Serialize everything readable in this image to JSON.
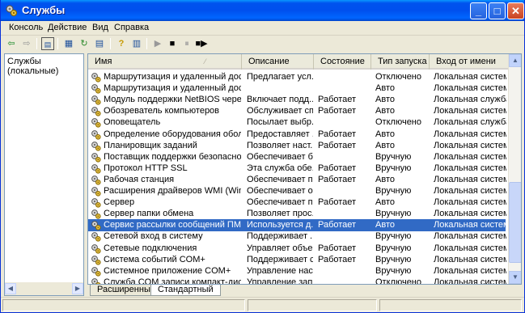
{
  "window": {
    "title": "Службы"
  },
  "menu": [
    "Консоль",
    "Действие",
    "Вид",
    "Справка"
  ],
  "tree": {
    "root": "Службы (локальные)"
  },
  "columns": [
    "Имя",
    "Описание",
    "Состояние",
    "Тип запуска",
    "Вход от имени"
  ],
  "rows": [
    {
      "name": "Маршрутизация и удаленный доступ",
      "desc": "Предлагает усл...",
      "state": "",
      "startup": "Отключено",
      "logon": "Локальная система"
    },
    {
      "name": "Маршрутизация и удаленный доступ ...",
      "desc": "",
      "state": "",
      "startup": "Авто",
      "logon": "Локальная система"
    },
    {
      "name": "Модуль поддержки NetBIOS через TC...",
      "desc": "Включает подд...",
      "state": "Работает",
      "startup": "Авто",
      "logon": "Локальная служба"
    },
    {
      "name": "Обозреватель компьютеров",
      "desc": "Обслуживает сп...",
      "state": "Работает",
      "startup": "Авто",
      "logon": "Локальная система"
    },
    {
      "name": "Оповещатель",
      "desc": "Посылает выбр...",
      "state": "",
      "startup": "Отключено",
      "logon": "Локальная служба"
    },
    {
      "name": "Определение оборудования оболочки",
      "desc": "Предоставляет ...",
      "state": "Работает",
      "startup": "Авто",
      "logon": "Локальная система"
    },
    {
      "name": "Планировщик заданий",
      "desc": "Позволяет наст...",
      "state": "Работает",
      "startup": "Авто",
      "logon": "Локальная система"
    },
    {
      "name": "Поставщик поддержки безопасности ...",
      "desc": "Обеспечивает б...",
      "state": "",
      "startup": "Вручную",
      "logon": "Локальная система"
    },
    {
      "name": "Протокол HTTP SSL",
      "desc": "Эта служба обе...",
      "state": "Работает",
      "startup": "Вручную",
      "logon": "Локальная система"
    },
    {
      "name": "Рабочая станция",
      "desc": "Обеспечивает п...",
      "state": "Работает",
      "startup": "Авто",
      "logon": "Локальная система"
    },
    {
      "name": "Расширения драйверов WMI (Windows...",
      "desc": "Обеспечивает о...",
      "state": "",
      "startup": "Вручную",
      "logon": "Локальная система"
    },
    {
      "name": "Сервер",
      "desc": "Обеспечивает п...",
      "state": "Работает",
      "startup": "Авто",
      "logon": "Локальная система"
    },
    {
      "name": "Сервер папки обмена",
      "desc": "Позволяет прос...",
      "state": "",
      "startup": "Вручную",
      "logon": "Локальная система"
    },
    {
      "name": "Сервис рассылки сообщений ПМТ",
      "desc": "Используется д...",
      "state": "Работает",
      "startup": "Авто",
      "logon": "Локальная система",
      "selected": true
    },
    {
      "name": "Сетевой вход в систему",
      "desc": "Поддерживает ...",
      "state": "",
      "startup": "Вручную",
      "logon": "Локальная система"
    },
    {
      "name": "Сетевые подключения",
      "desc": "Управляет объе...",
      "state": "Работает",
      "startup": "Вручную",
      "logon": "Локальная система"
    },
    {
      "name": "Система событий COM+",
      "desc": "Поддерживает с...",
      "state": "Работает",
      "startup": "Вручную",
      "logon": "Локальная система"
    },
    {
      "name": "Системное приложение COM+",
      "desc": "Управление нас...",
      "state": "",
      "startup": "Вручную",
      "logon": "Локальная система"
    },
    {
      "name": "Служба COM записи компакт-дисков I...",
      "desc": "Управление запи...",
      "state": "",
      "startup": "Отключено",
      "logon": "Локальная система"
    }
  ],
  "tabs": [
    {
      "label": "Расширенный",
      "active": false
    },
    {
      "label": "Стандартный",
      "active": true
    }
  ],
  "colors": {
    "title_bar": "#0053ee",
    "selection": "#316ac5"
  },
  "icons": [
    "services-app-icon",
    "back-arrow-icon",
    "forward-arrow-icon",
    "console-tree-icon",
    "properties-icon",
    "refresh-icon",
    "export-list-icon",
    "help-icon",
    "action-pane-icon",
    "start-service-icon",
    "stop-service-icon",
    "pause-service-icon",
    "restart-service-icon",
    "service-gear-icon"
  ]
}
